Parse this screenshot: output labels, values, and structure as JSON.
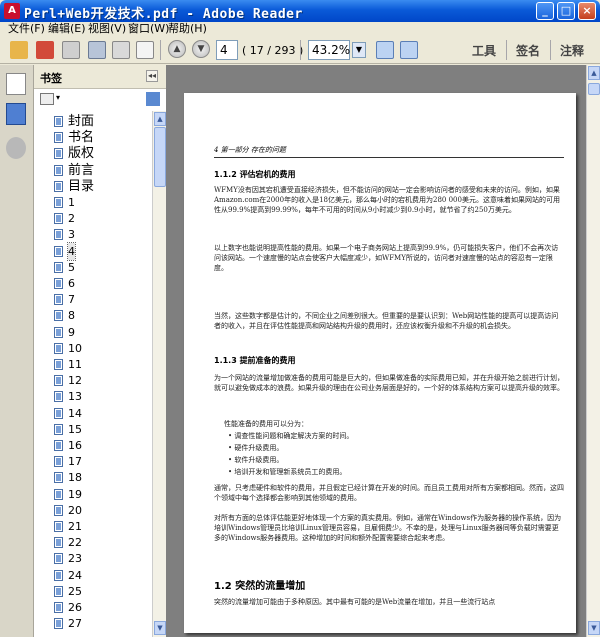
{
  "window": {
    "title": "Perl+Web开发技术.pdf - Adobe Reader",
    "buttons": {
      "minimize": "_",
      "maximize": "□",
      "close": "×"
    }
  },
  "menu": [
    "文件(F)",
    "编辑(E)",
    "视图(V)",
    "窗口(W)",
    "帮助(H)"
  ],
  "toolbar": {
    "page_current": "4",
    "page_total": "( 17 / 293 )",
    "zoom": "43.2%",
    "tools_label": "工具",
    "sign_label": "签名",
    "comment_label": "注释"
  },
  "bookmarks": {
    "panel_title": "书签",
    "items": [
      "封面",
      "书名",
      "版权",
      "前言",
      "目录",
      "1",
      "2",
      "3",
      "4",
      "5",
      "6",
      "7",
      "8",
      "9",
      "10",
      "11",
      "12",
      "13",
      "14",
      "15",
      "16",
      "17",
      "18",
      "19",
      "20",
      "21",
      "22",
      "23",
      "24",
      "25",
      "26",
      "27"
    ],
    "selected_index": 8
  },
  "document": {
    "running_head": "4    第一部分  存在的问题",
    "section_1_1_2": "1.1.2  评估宕机的费用",
    "section_1_1_3": "1.1.3  提前准备的费用",
    "section_1_2": "1.2  突然的流量增加",
    "para1": "WFMY没有因其宕机遭受直接经济损失，但不能访问的网站一定会影响访问者的感受和未来的访问。例如，如果Amazon.com在2000年的收入是18亿美元，那么每小时的宕机费用为280 000美元。这意味着如果网站的可用性从99.9%提高到99.99%，每年不可用的时间从9小时减少到0.9小时，就节省了约250万美元。",
    "para2": "以上数字也能说明提高性能的费用。如果一个电子商务网站上提高到99.9%，仍可能损失客户，他们不会再次访问该网站。一个速度慢的站点会使客户大幅度减少，如WFMY所说的，访问者对速度慢的站点的容忍有一定限度。",
    "para3": "当然，这些数字都是估计的，不同企业之间差别很大。但重要的是要认识到：Web网站性能的提高可以提高访问者的收入，并且在评估性能提高和网站结构升级的费用时，还应该权衡升级和不升级的机会损失。",
    "para4": "为一个网站的流量增加做准备的费用可能是巨大的，但如果做准备的实际费用已知，并在升级开始之前进行计划，就可以避免做成本的浪费。如果升级的理由在公司业务层面是好的，一个好的体系结构方案可以提高升级的效率。",
    "bullets_intro": "性能准备的费用可以分为：",
    "bullets": [
      "调查性能问题和确定解决方案的时间。",
      "硬件升级费用。",
      "软件升级费用。",
      "培训开发和管理新系统员工的费用。"
    ],
    "para5": "通常，只考虑硬件和软件的费用，并且假定已经计算在开发的时间。而且员工费用对所有方案都相同。然而，这四个领域中每个选择都会影响到其他领域的费用。",
    "para6": "对所有方面的总体评估能更好地体现一个方案的真实费用。例如，通常在Windows作为服务器的操作系统，因为培训Windows管理员比培训Linux管理员容易，且雇佣费少。不幸的是，处理与Linux服务器同等负载时需要更多的Windows服务器费用。这种增加的时间和额外配置需要综合起来考虑。",
    "para7": "突然的流量增加可能由于多种原因。其中最有可能的是Web流量在增加，并且一些流行站点"
  }
}
